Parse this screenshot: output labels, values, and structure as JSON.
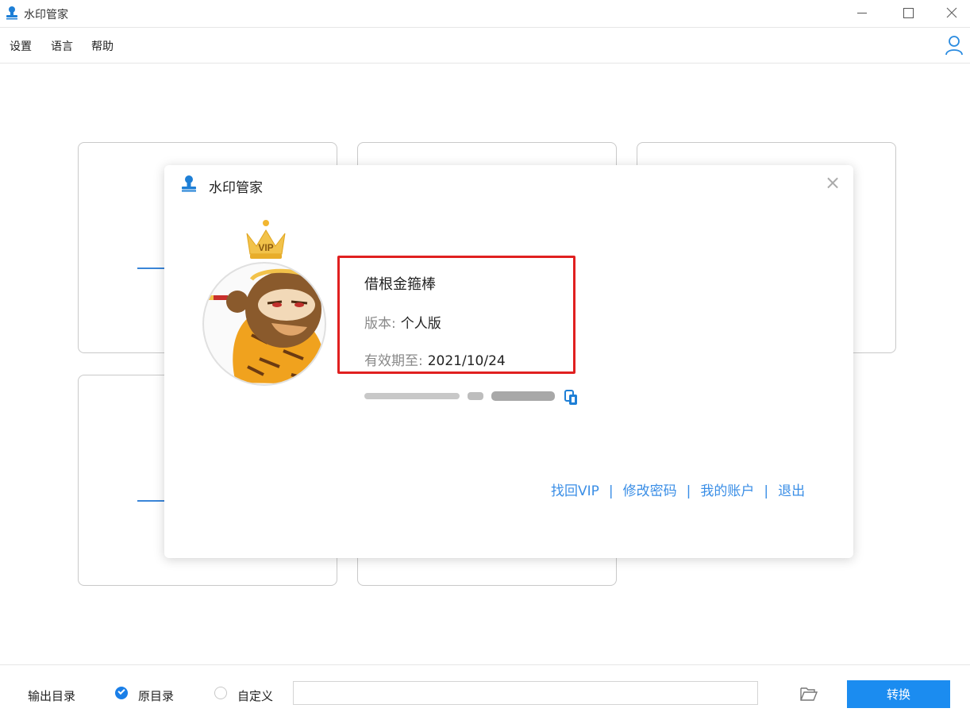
{
  "app": {
    "title": "水印管家"
  },
  "menu": {
    "items": [
      "设置",
      "语言",
      "帮助"
    ]
  },
  "dialog": {
    "title": "水印管家",
    "badge": "VIP",
    "user_name": "借根金箍棒",
    "version_label": "版本:",
    "version_value": "个人版",
    "expiry_label": "有效期至:",
    "expiry_value": "2021/10/24",
    "links": [
      "找回VIP",
      "修改密码",
      "我的账户",
      "退出"
    ]
  },
  "bottom": {
    "output_label": "输出目录",
    "option_original": "原目录",
    "option_custom": "自定义",
    "selected_option": "原目录",
    "path_value": "",
    "convert_label": "转换"
  },
  "colors": {
    "accent": "#1b8cf0",
    "link": "#3a8ee6",
    "highlight": "#e02020"
  }
}
